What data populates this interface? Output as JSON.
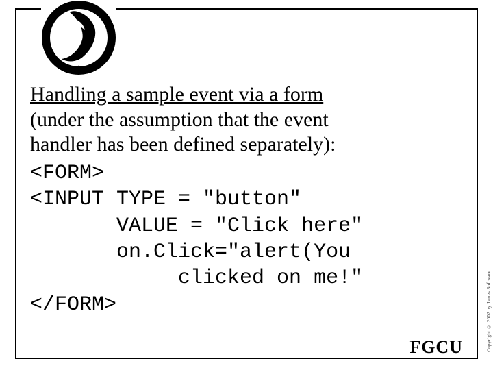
{
  "heading": {
    "title": "Handling a sample event via a form",
    "subtitle_line1": "(under the assumption that the event",
    "subtitle_line2": "handler has been defined separately):"
  },
  "code": {
    "line1": "<FORM>",
    "line2": "<INPUT TYPE = \"button\"",
    "line3": "       VALUE = \"Click here\"",
    "line4": "       on.Click=\"alert(You",
    "line5": "            clicked on me!\"",
    "line6": "</FORM>"
  },
  "footer": {
    "brand": "FGCU"
  },
  "copyright": "Copyright © 2002 by James Software"
}
